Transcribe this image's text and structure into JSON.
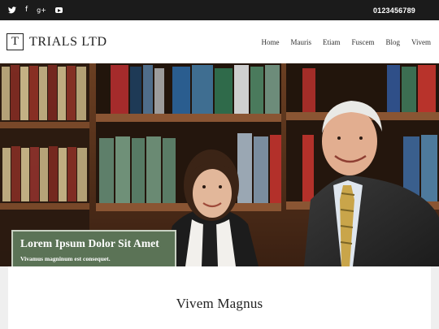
{
  "topbar": {
    "social_icons": [
      "twitter-icon",
      "facebook-icon",
      "google-plus-icon",
      "youtube-icon"
    ],
    "twitter_glyph": "🐦",
    "facebook_glyph": "f",
    "googleplus_glyph": "g+",
    "phone": "0123456789"
  },
  "header": {
    "logo_letter": "T",
    "logo_text": "TRIALS LTD"
  },
  "nav": {
    "items": [
      "Home",
      "Mauris",
      "Etiam",
      "Fuscem",
      "Blog",
      "Vivem"
    ]
  },
  "hero": {
    "caption_title": "Lorem Ipsum Dolor Sit Amet",
    "caption_subtitle": "Vivamus magninum est consequet."
  },
  "content": {
    "title": "Vivem Magnus"
  },
  "colors": {
    "topbar_bg": "#1b1b1b",
    "caption_bg": "#5b7356",
    "page_bg": "#efefef"
  }
}
